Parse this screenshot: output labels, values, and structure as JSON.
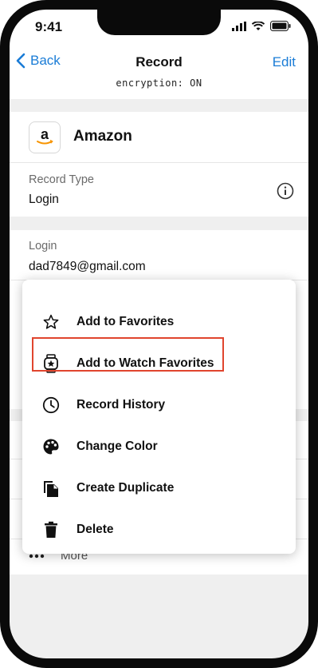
{
  "status": {
    "time": "9:41"
  },
  "nav": {
    "back_label": "Back",
    "title": "Record",
    "edit_label": "Edit",
    "subtitle": "encryption: ON"
  },
  "record": {
    "name": "Amazon",
    "logo_letter": "a"
  },
  "record_type": {
    "label": "Record Type",
    "value": "Login"
  },
  "login": {
    "label": "Login",
    "value": "dad7849@gmail.com"
  },
  "behind": {
    "more_label": "More"
  },
  "menu": {
    "items": [
      {
        "label": "Add to Favorites",
        "icon": "star-outline-icon"
      },
      {
        "label": "Add to Watch Favorites",
        "icon": "watch-star-icon"
      },
      {
        "label": "Record History",
        "icon": "clock-icon"
      },
      {
        "label": "Change Color",
        "icon": "palette-icon"
      },
      {
        "label": "Create Duplicate",
        "icon": "duplicate-icon"
      },
      {
        "label": "Delete",
        "icon": "trash-icon"
      }
    ]
  },
  "colors": {
    "accent": "#1a7cd6",
    "highlight": "#e0452e",
    "separator": "#efefef"
  }
}
